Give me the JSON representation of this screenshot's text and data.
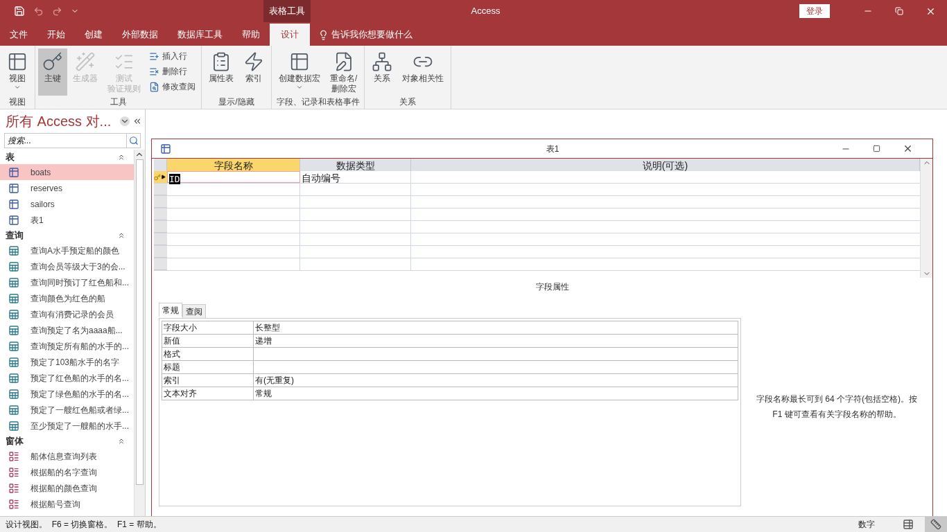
{
  "titlebar": {
    "context_label": "表格工具",
    "app_title": "Access",
    "login": "登录"
  },
  "menu_tabs": [
    {
      "label": "文件",
      "selected": false
    },
    {
      "label": "开始",
      "selected": false
    },
    {
      "label": "创建",
      "selected": false
    },
    {
      "label": "外部数据",
      "selected": false
    },
    {
      "label": "数据库工具",
      "selected": false
    },
    {
      "label": "帮助",
      "selected": false
    },
    {
      "label": "设计",
      "selected": true
    }
  ],
  "tell_me": "告诉我你想要做什么",
  "ribbon": [
    {
      "label": "视图",
      "buttons": [
        {
          "label": "视图",
          "kind": "large-dropdown",
          "disabled": false,
          "selected": false
        }
      ]
    },
    {
      "label": "工具",
      "buttons": [
        {
          "label": "主键",
          "kind": "large",
          "disabled": false,
          "selected": true
        },
        {
          "label": "生成器",
          "kind": "large",
          "disabled": true,
          "selected": false
        },
        {
          "lines": [
            "测试",
            "验证规则"
          ],
          "kind": "large",
          "disabled": true,
          "selected": false
        },
        {
          "label": "插入行",
          "kind": "small",
          "disabled": false,
          "selected": false
        },
        {
          "label": "删除行",
          "kind": "small",
          "disabled": false,
          "selected": false
        },
        {
          "label": "修改查阅",
          "kind": "small",
          "disabled": false,
          "selected": false
        }
      ]
    },
    {
      "label": "显示/隐藏",
      "buttons": [
        {
          "label": "属性表",
          "kind": "large",
          "disabled": false,
          "selected": false
        },
        {
          "label": "索引",
          "kind": "large",
          "disabled": false,
          "selected": false
        }
      ]
    },
    {
      "label": "字段、记录和表格事件",
      "buttons": [
        {
          "label": "创建数据宏",
          "kind": "large-dropdown",
          "disabled": false,
          "selected": false
        },
        {
          "lines": [
            "重命名/",
            "删除宏"
          ],
          "kind": "large",
          "disabled": false,
          "selected": false
        }
      ]
    },
    {
      "label": "关系",
      "buttons": [
        {
          "label": "关系",
          "kind": "large",
          "disabled": false,
          "selected": false
        },
        {
          "label": "对象相关性",
          "kind": "large",
          "disabled": false,
          "selected": false
        }
      ]
    }
  ],
  "navigation": {
    "title": "所有 Access 对...",
    "search": {
      "placeholder": "搜索..."
    },
    "groups": [
      {
        "label": "表",
        "kind": "table",
        "items": [
          {
            "label": "boats",
            "selected": true
          },
          {
            "label": "reserves",
            "selected": false
          },
          {
            "label": "sailors",
            "selected": false
          },
          {
            "label": "表1",
            "selected": false
          }
        ]
      },
      {
        "label": "查询",
        "kind": "query",
        "items": [
          {
            "label": "查询A水手预定船的颜色",
            "selected": false
          },
          {
            "label": "查询会员等级大于3的会...",
            "selected": false
          },
          {
            "label": "查询同时预订了红色船和...",
            "selected": false
          },
          {
            "label": "查询颜色为红色的船",
            "selected": false
          },
          {
            "label": "查询有消费记录的会员",
            "selected": false
          },
          {
            "label": "查询预定了名为aaaa船...",
            "selected": false
          },
          {
            "label": "查询预定所有船的水手的...",
            "selected": false
          },
          {
            "label": "预定了103船水手的名字",
            "selected": false
          },
          {
            "label": "预定了红色船的水手的名...",
            "selected": false
          },
          {
            "label": "预定了绿色船的水手的名...",
            "selected": false
          },
          {
            "label": "预定了一艘红色船或者绿...",
            "selected": false
          },
          {
            "label": "至少预定了一艘船的水手...",
            "selected": false
          }
        ]
      },
      {
        "label": "窗体",
        "kind": "form",
        "items": [
          {
            "label": "船体信息查询列表",
            "selected": false
          },
          {
            "label": "根据船的名字查询",
            "selected": false
          },
          {
            "label": "根据船的颜色查询",
            "selected": false
          },
          {
            "label": "根据船号查询",
            "selected": false
          }
        ]
      }
    ]
  },
  "table_window": {
    "title": "表1",
    "columns": [
      "字段名称",
      "数据类型",
      "说明(可选)"
    ],
    "rows": [
      {
        "field_name": "ID",
        "data_type": "自动编号",
        "primary_key": true,
        "selected": true
      }
    ],
    "properties_heading": "字段属性",
    "property_tabs": [
      {
        "label": "常规",
        "selected": true
      },
      {
        "label": "查阅",
        "selected": false
      }
    ],
    "properties": [
      {
        "label": "字段大小",
        "value": "长整型"
      },
      {
        "label": "新值",
        "value": "递增"
      },
      {
        "label": "格式"
      },
      {
        "label": "标题"
      },
      {
        "label": "索引",
        "value": "有(无重复)"
      },
      {
        "label": "文本对齐",
        "value": "常规"
      }
    ],
    "help": "字段名称最长可到 64 个字符(包括空格)。按 F1 键可查看有关字段名称的帮助。"
  },
  "status_bar": {
    "text": "设计视图。  F6 = 切换窗格。  F1 = 帮助。",
    "indicator": "数字"
  }
}
